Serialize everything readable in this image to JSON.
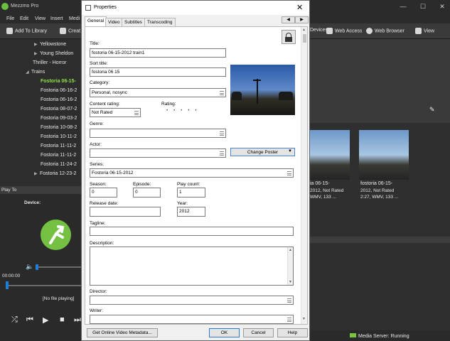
{
  "app": {
    "title": "Mezzmo Pro",
    "window_controls": [
      "—",
      "☐",
      "✕"
    ],
    "menu": [
      "File",
      "Edit",
      "View",
      "Insert",
      "Medi"
    ],
    "toolbar": {
      "add_to_library": "Add To Library",
      "create": "Creat",
      "devices": "Devices",
      "web_access": "Web Access",
      "web_browser": "Web Browser",
      "view": "View"
    },
    "tree": [
      {
        "label": "Yellowstone",
        "arrow": "▶"
      },
      {
        "label": "Young Sheldon",
        "arrow": "▶"
      },
      {
        "label": "Thriller - Horror",
        "arrow": ""
      },
      {
        "label": "Trains",
        "arrow": "◢"
      },
      {
        "label": "Fostoria 06-15-"
      },
      {
        "label": "Fostoria 06-16-2"
      },
      {
        "label": "Fostoria 06-16-2"
      },
      {
        "label": "Fostoria 08-07-2"
      },
      {
        "label": "Fostoria 09-03-2"
      },
      {
        "label": "Fostoria 10-08-2"
      },
      {
        "label": "Fostoria 10-11-2"
      },
      {
        "label": "Fostoria 11-11-2"
      },
      {
        "label": "Fostoria 11-11-2"
      },
      {
        "label": "Fostoria 11-24-2"
      },
      {
        "label": "Fostoria 12-23-2",
        "arrow": "▶"
      }
    ],
    "play_to": {
      "header": "Play To",
      "device_label": "Device:",
      "time": "00:00:00",
      "status": "[No file playing]",
      "controls": [
        "⤮",
        "⏮",
        "▶",
        "■",
        "⏭"
      ]
    },
    "thumbnails": [
      {
        "title": "ia 06-15-",
        "line2": "2012, Not Rated",
        "line3": "WMV, 133 ..."
      },
      {
        "title": "fostoria 06-15-",
        "line2": "2012, Not Rated",
        "line3": "2:27, WMV, 133 ..."
      }
    ],
    "server_status": "Media Server: Running"
  },
  "dialog": {
    "title": "Properties",
    "tabs": [
      "General",
      "Video",
      "Subtitles",
      "Transcoding"
    ],
    "nav": {
      "prev": "◀",
      "next": "▶"
    },
    "fields": {
      "title": {
        "label": "Title:",
        "value": "fostoria 06-15-2012 train1"
      },
      "sort_title": {
        "label": "Sort title:",
        "value": "fostoria 06 15"
      },
      "category": {
        "label": "Category:",
        "value": "Personal, nosync"
      },
      "content_rating": {
        "label": "Content rating:",
        "value": "Not Rated"
      },
      "rating": {
        "label": "Rating:",
        "value": "• • • • •"
      },
      "genre": {
        "label": "Genre:",
        "value": ""
      },
      "actor": {
        "label": "Actor:",
        "value": ""
      },
      "series": {
        "label": "Series:",
        "value": "Fostoria 06-15-2012"
      },
      "season": {
        "label": "Season:",
        "value": "0"
      },
      "episode": {
        "label": "Episode:",
        "value": "0"
      },
      "play_count": {
        "label": "Play count:",
        "value": "1"
      },
      "release_date": {
        "label": "Release date:",
        "value": ""
      },
      "year": {
        "label": "Year:",
        "value": "2012"
      },
      "tagline": {
        "label": "Tagline:",
        "value": ""
      },
      "description": {
        "label": "Description:",
        "value": ""
      },
      "director": {
        "label": "Director:",
        "value": ""
      },
      "writer": {
        "label": "Writer:",
        "value": ""
      }
    },
    "change_poster": "Change Poster",
    "buttons": {
      "metadata": "Get Online Video Metadata...",
      "ok": "OK",
      "cancel": "Cancel",
      "help": "Help"
    }
  },
  "colors": {
    "accent_green": "#8ee04a",
    "logo_green": "#74c043",
    "focus_blue": "#2e78d6",
    "slider_blue": "#1c7fd4"
  },
  "icons": [
    "lock-icon",
    "close-icon",
    "volume-icon",
    "shuffle-icon",
    "previous-icon",
    "play-icon",
    "stop-icon",
    "next-icon",
    "edit-icon"
  ]
}
